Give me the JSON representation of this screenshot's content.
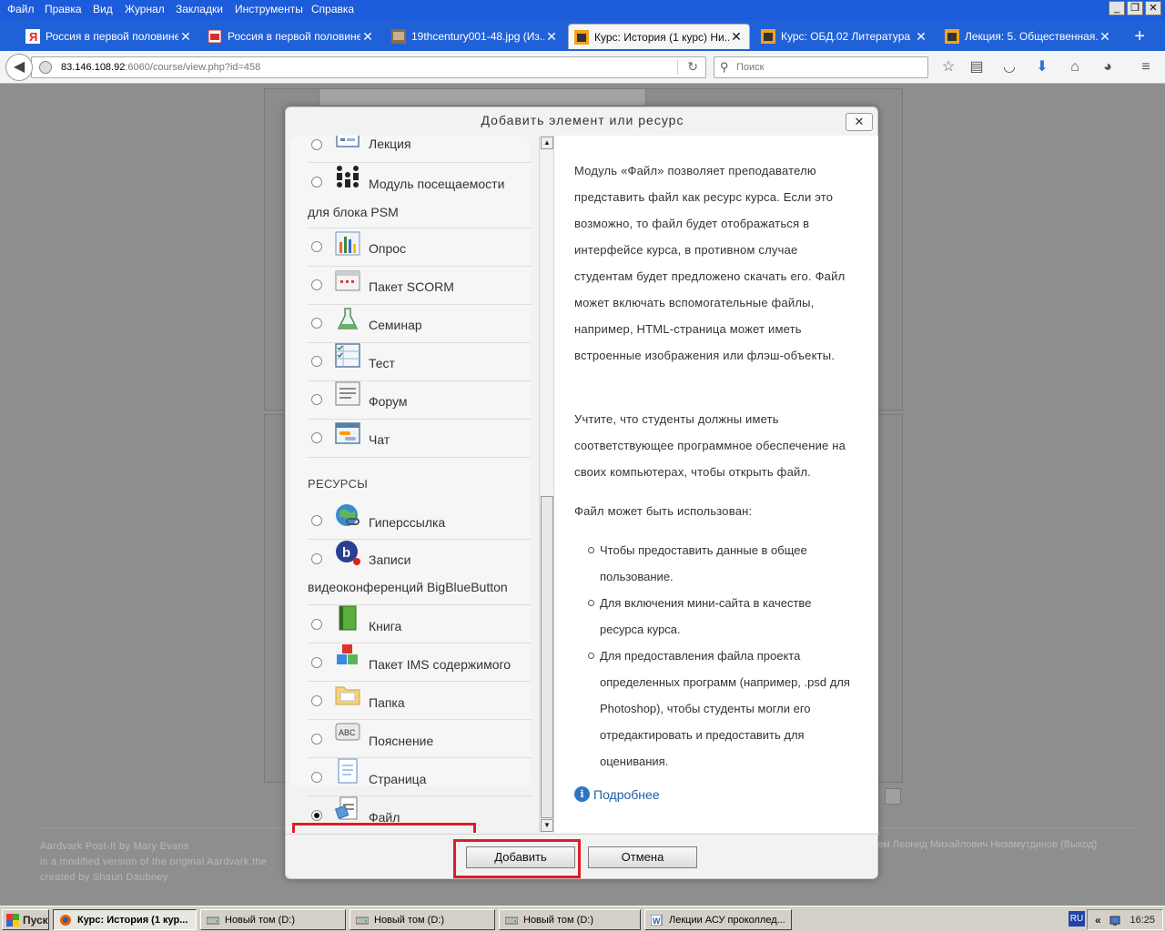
{
  "menu": [
    "Файл",
    "Правка",
    "Вид",
    "Журнал",
    "Закладки",
    "Инструменты",
    "Справка"
  ],
  "tabs": [
    {
      "label": "Россия в первой половине...",
      "icon": "yandex-icon"
    },
    {
      "label": "Россия в первой половине...",
      "icon": "image-doc-icon"
    },
    {
      "label": "19thcentury001-48.jpg (Из...",
      "icon": "thumbnail-icon"
    },
    {
      "label": "Курс: История (1 курс) Ни...",
      "icon": "moodle-icon"
    },
    {
      "label": "Курс: ОБД.02 Литература",
      "icon": "moodle-icon"
    },
    {
      "label": "Лекция: 5. Общественная...",
      "icon": "moodle-icon"
    }
  ],
  "url": {
    "host": "83.146.108.92",
    "rest": ":6060/course/view.php?id=458"
  },
  "search": {
    "placeholder": "Поиск"
  },
  "modal": {
    "title": "Добавить элемент или ресурс",
    "close": "✕",
    "resources_heading": "РЕСУРСЫ",
    "activities": [
      {
        "line1": "Лекция",
        "icon": "lesson-icon"
      },
      {
        "line1": "Модуль посещаемости",
        "line2": "для блока PSM",
        "icon": "attendance-icon"
      },
      {
        "line1": "Опрос",
        "icon": "survey-icon"
      },
      {
        "line1": "Пакет SCORM",
        "icon": "scorm-icon"
      },
      {
        "line1": "Семинар",
        "icon": "workshop-icon"
      },
      {
        "line1": "Тест",
        "icon": "quiz-icon"
      },
      {
        "line1": "Форум",
        "icon": "forum-icon"
      },
      {
        "line1": "Чат",
        "icon": "chat-icon"
      }
    ],
    "resources": [
      {
        "line1": "Гиперссылка",
        "icon": "url-icon"
      },
      {
        "line1": "Записи",
        "line2": "видеоконференций BigBlueButton",
        "icon": "bigbluebutton-icon"
      },
      {
        "line1": "Книга",
        "icon": "book-icon"
      },
      {
        "line1": "Пакет IMS содержимого",
        "icon": "ims-icon"
      },
      {
        "line1": "Папка",
        "icon": "folder-icon"
      },
      {
        "line1": "Пояснение",
        "icon": "label-icon"
      },
      {
        "line1": "Страница",
        "icon": "page-icon"
      },
      {
        "line1": "Файл",
        "icon": "file-icon",
        "selected": true
      }
    ],
    "description": {
      "p1": "Модуль «Файл» позволяет преподавателю представить файл как ресурс курса. Если это возможно, то файл будет отображаться в интерфейсе курса, в противном случае студентам будет предложено скачать его. Файл может включать вспомогательные файлы, например, HTML-страница может иметь встроенные изображения или флэш-объекты.",
      "p2": "Учтите, что студенты должны иметь соответствующее программное обеспечение на своих компьютерах, чтобы открыть файл.",
      "p3": "Файл может быть использован:",
      "bullets": [
        "Чтобы предоставить данные в общее пользование.",
        "Для включения мини-сайта в качестве ресурса курса.",
        "Для предоставления файла проекта определенных программ (например, .psd для Photoshop), чтобы студенты могли его отредактировать и предоставить для оценивания."
      ],
      "more": "Подробнее"
    },
    "add_button": "Добавить",
    "cancel_button": "Отмена"
  },
  "footer": {
    "line1": "Aardvark Post-It by Mary Evans",
    "line2": "is a modified version of the original Aardvark the",
    "line3": "created by Shaun Daubney",
    "right": "ем Леонид Михайлович Низамутдинов (Выход)"
  },
  "taskbar": {
    "start": "Пуск",
    "items": [
      {
        "label": "Курс: История (1 кур...",
        "icon": "firefox-icon",
        "active": true
      },
      {
        "label": "Новый том (D:)",
        "icon": "drive-icon"
      },
      {
        "label": "Новый том (D:)",
        "icon": "drive-icon"
      },
      {
        "label": "Новый том (D:)",
        "icon": "drive-icon"
      },
      {
        "label": "Лекции АСУ проколлед...",
        "icon": "word-icon"
      }
    ],
    "lang": "RU",
    "tray_arrow": "«",
    "clock": "16:25"
  },
  "colors": {
    "highlight": "#e21b24",
    "taskbar": "#d4d0c8",
    "titlebar": "#2161d8"
  }
}
